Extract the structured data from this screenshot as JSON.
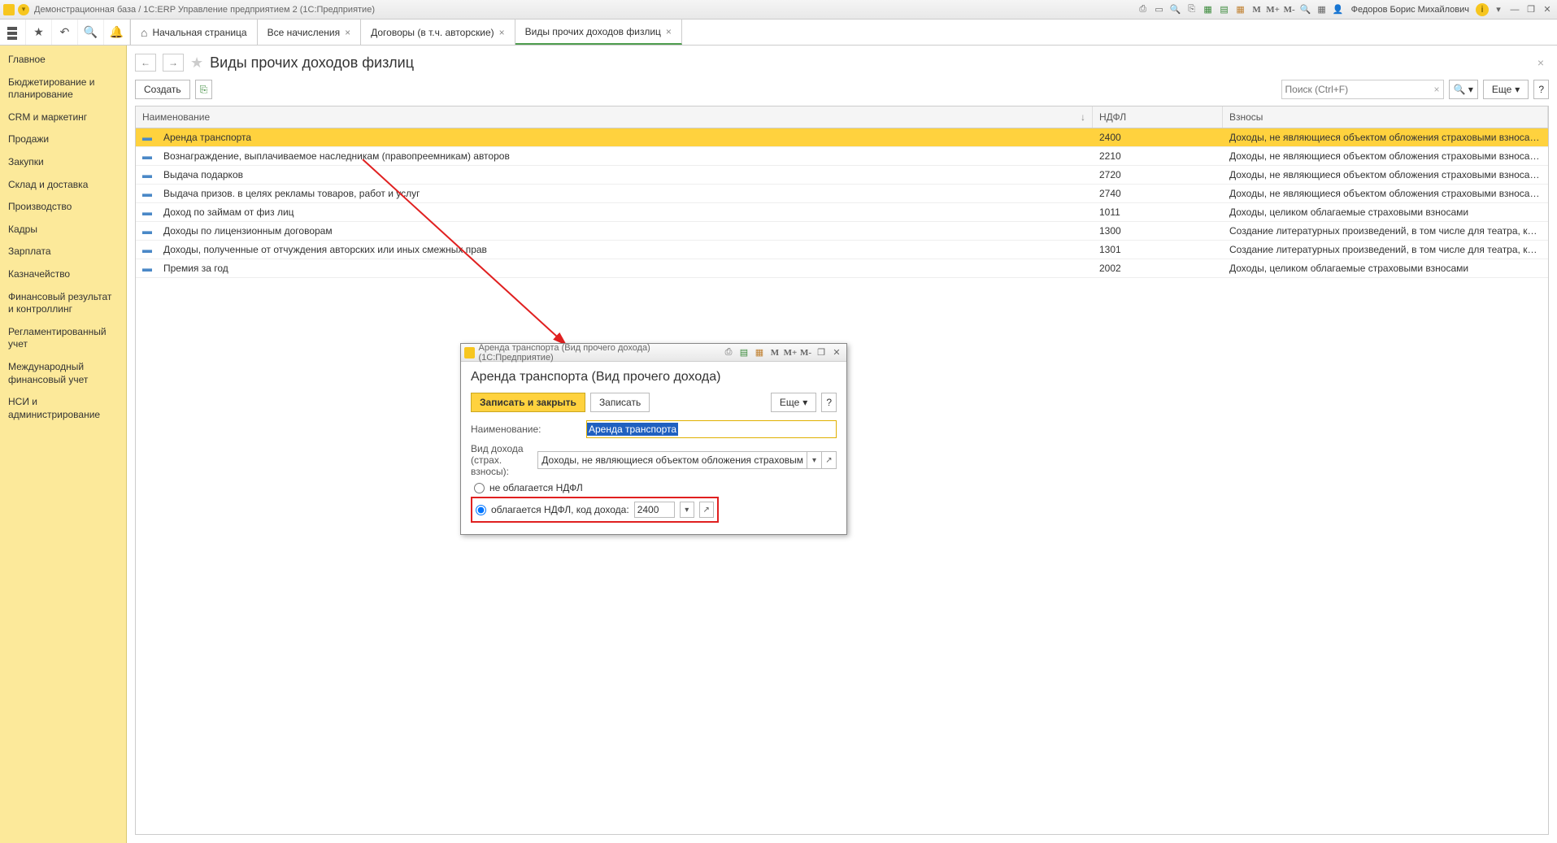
{
  "app": {
    "title": "Демонстрационная база / 1С:ERP Управление предприятием 2  (1С:Предприятие)",
    "user": "Федоров Борис Михайлович",
    "tb_icons": {
      "m1": "M",
      "mplus": "M+",
      "mminus": "M-",
      "info": "i"
    }
  },
  "tabs": {
    "home": "Начальная страница",
    "t1": "Все начисления",
    "t2": "Договоры (в т.ч. авторские)",
    "t3": "Виды прочих доходов физлиц"
  },
  "sidebar": {
    "items": [
      "Главное",
      "Бюджетирование и планирование",
      "CRM и маркетинг",
      "Продажи",
      "Закупки",
      "Склад и доставка",
      "Производство",
      "Кадры",
      "Зарплата",
      "Казначейство",
      "Финансовый результат и контроллинг",
      "Регламентированный учет",
      "Международный финансовый учет",
      "НСИ и администрирование"
    ]
  },
  "page": {
    "title": "Виды прочих доходов физлиц",
    "create": "Создать",
    "search_ph": "Поиск (Ctrl+F)",
    "more": "Еще",
    "help": "?"
  },
  "table": {
    "cols": {
      "name": "Наименование",
      "ndfl": "НДФЛ",
      "vzn": "Взносы"
    },
    "rows": [
      {
        "name": "Аренда транспорта",
        "ndfl": "2400",
        "vzn": "Доходы, не являющиеся объектом обложения страховыми взносами",
        "sel": true
      },
      {
        "name": "Вознаграждение, выплачиваемое наследникам (правопреемникам) авторов",
        "ndfl": "2210",
        "vzn": "Доходы, не являющиеся объектом обложения страховыми взносами"
      },
      {
        "name": "Выдача подарков",
        "ndfl": "2720",
        "vzn": "Доходы, не являющиеся объектом обложения страховыми взносами"
      },
      {
        "name": "Выдача призов. в целях рекламы товаров, работ и услуг",
        "ndfl": "2740",
        "vzn": "Доходы, не являющиеся объектом обложения страховыми взносами"
      },
      {
        "name": "Доход по займам от физ лиц",
        "ndfl": "1011",
        "vzn": "Доходы, целиком облагаемые страховыми взносами"
      },
      {
        "name": "Доходы по лицензионным договорам",
        "ndfl": "1300",
        "vzn": "Создание литературных произведений, в том числе для театра, кино, эстрад..."
      },
      {
        "name": "Доходы, полученные от отчуждения авторских или иных смежных прав",
        "ndfl": "1301",
        "vzn": "Создание литературных произведений, в том числе для театра, кино, эстрад..."
      },
      {
        "name": "Премия за год",
        "ndfl": "2002",
        "vzn": "Доходы, целиком облагаемые страховыми взносами"
      }
    ]
  },
  "dialog": {
    "win_title": "Аренда транспорта (Вид прочего дохода)  (1С:Предприятие)",
    "title": "Аренда транспорта (Вид прочего дохода)",
    "save_close": "Записать и закрыть",
    "save": "Записать",
    "more": "Еще",
    "help": "?",
    "lbl_name": "Наименование:",
    "val_name": "Аренда транспорта",
    "lbl_kind": "Вид дохода (страх. взносы):",
    "val_kind": "Доходы, не являющиеся объектом обложения страховым",
    "radio_no": "не облагается НДФЛ",
    "radio_yes": "облагается НДФЛ, код дохода:",
    "code": "2400"
  }
}
